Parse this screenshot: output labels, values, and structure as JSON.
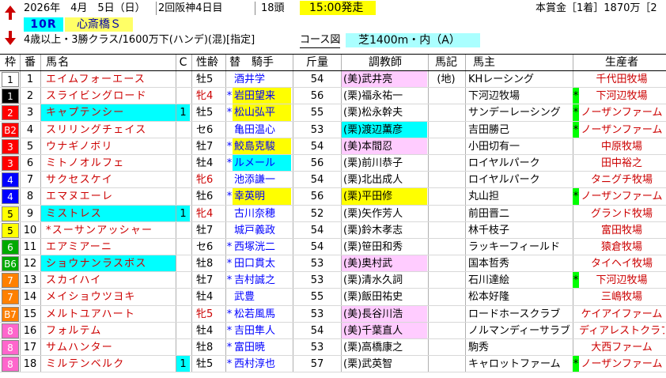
{
  "header": {
    "date": "2026年　4月　5日（日）",
    "meeting": "2回阪神4日目",
    "runners": "18頭",
    "post_time": "15:00発走",
    "prize": "本賞金［1着］1870万［2",
    "race_number": "10R",
    "race_name": "心斎橋Ｓ",
    "conditions": "4歳以上・3勝クラス/1600万下(ハンデ)(混)[指定]",
    "course_label": "コース図",
    "course": "芝1400m・内（A）"
  },
  "columns": {
    "waku": "枠",
    "ban": "番",
    "horse": "馬名",
    "blink": "C",
    "sexage": "性齢",
    "jockey": "替　騎手",
    "kin": "斤量",
    "trainer": "調教師",
    "memo": "馬記",
    "owner": "馬主",
    "breeder": "生産者"
  },
  "colors": {
    "waku": [
      "#ffffff",
      "#000000",
      "#ff0000",
      "#0000ff",
      "#ffff00",
      "#00aa00",
      "#ff8000",
      "#ff66cc"
    ],
    "jockey_highlight": "#ffff00",
    "jockey_highlight2": "#00ffff",
    "trainer_ritto": "#ffccff",
    "trainer_ritto_hl": "#00ffff",
    "horse_blink_hl": "#00ffff"
  },
  "rows": [
    {
      "waku": "1",
      "wc": 0,
      "ban": "1",
      "horse": "エイムフォーエース",
      "blink": "",
      "sexage": "牡5",
      "mark": "",
      "jockey": "酒井学",
      "jhl": "",
      "kin": "54",
      "trainer": "(美)武井亮",
      "thl": "miho",
      "memo": "(地)",
      "owner": "KHレーシング",
      "gm": "",
      "breeder": "千代田牧場",
      "hhl": ""
    },
    {
      "waku": "1",
      "wc": 1,
      "ban": "2",
      "horse": "スライビングロード",
      "blink": "",
      "sexage": "牝4",
      "sexred": true,
      "mark": "*",
      "jockey": "岩田望来",
      "jhl": "y",
      "kin": "56",
      "trainer": "(栗)福永祐一",
      "thl": "",
      "memo": "",
      "owner": "下河辺牧場",
      "gm": "",
      "breeder": "下河辺牧場",
      "bgm": "*"
    },
    {
      "waku": "2",
      "wc": 2,
      "ban": "3",
      "horse": "キャプテンシー",
      "blink": "1",
      "sexage": "牡5",
      "mark": "*",
      "jockey": "松山弘平",
      "jhl": "y",
      "kin": "55",
      "trainer": "(栗)松永幹夫",
      "thl": "",
      "memo": "",
      "owner": "サンデーレーシング",
      "gm": "",
      "breeder": "ノーザンファーム",
      "bgm": "*",
      "hhl": "c"
    },
    {
      "waku": "B2",
      "wc": 2,
      "ban": "4",
      "horse": "スリリングチェイス",
      "blink": "",
      "sexage": "セ6",
      "mark": "",
      "jockey": "亀田温心",
      "jhl": "",
      "kin": "53",
      "trainer": "(栗)渡辺薫彦",
      "thl": "c",
      "memo": "",
      "owner": "吉田勝己",
      "gm": "",
      "breeder": "ノーザンファーム",
      "bgm": "*"
    },
    {
      "waku": "3",
      "wc": 2,
      "ban": "5",
      "horse": "ウナギノボリ",
      "blink": "",
      "sexage": "牡7",
      "mark": "*",
      "jockey": "鮫島克駿",
      "jhl": "y",
      "kin": "54",
      "trainer": "(美)本間忍",
      "thl": "miho",
      "memo": "",
      "owner": "小田切有一",
      "gm": "",
      "breeder": "中原牧場"
    },
    {
      "waku": "3",
      "wc": 2,
      "ban": "6",
      "horse": "ミトノオルフェ",
      "blink": "",
      "sexage": "牡4",
      "mark": "*",
      "jockey": "ルメール",
      "jhl": "c",
      "kin": "56",
      "trainer": "(栗)前川恭子",
      "thl": "",
      "memo": "",
      "owner": "ロイヤルパーク",
      "gm": "",
      "breeder": "田中裕之"
    },
    {
      "waku": "4",
      "wc": 3,
      "ban": "7",
      "horse": "サクセスケイ",
      "blink": "",
      "sexage": "牝6",
      "sexred": true,
      "mark": "",
      "jockey": "池添謙一",
      "jhl": "",
      "kin": "54",
      "trainer": "(栗)北出成人",
      "thl": "",
      "memo": "",
      "owner": "ロイヤルパーク",
      "gm": "",
      "breeder": "タニグチ牧場"
    },
    {
      "waku": "4",
      "wc": 3,
      "ban": "8",
      "horse": "エマヌエーレ",
      "blink": "",
      "sexage": "牡6",
      "mark": "*",
      "jockey": "幸英明",
      "jhl": "y",
      "kin": "56",
      "trainer": "(栗)平田修",
      "thl": "y",
      "memo": "",
      "owner": "丸山担",
      "gm": "",
      "breeder": "ノーザンファーム",
      "bgm": "*"
    },
    {
      "waku": "5",
      "wc": 4,
      "ban": "9",
      "horse": "ミストレス",
      "blink": "1",
      "sexage": "牝4",
      "sexred": true,
      "mark": "",
      "jockey": "古川奈穂",
      "jhl": "",
      "kin": "52",
      "trainer": "(栗)矢作芳人",
      "thl": "",
      "memo": "",
      "owner": "前田晋二",
      "gm": "",
      "breeder": "グランド牧場",
      "hhl": "c"
    },
    {
      "waku": "5",
      "wc": 4,
      "ban": "10",
      "horse": "*スーサンアッシャー",
      "blink": "",
      "sexage": "牡7",
      "mark": "",
      "jockey": "城戸義政",
      "jhl": "",
      "kin": "54",
      "trainer": "(栗)鈴木孝志",
      "thl": "",
      "memo": "",
      "owner": "林千枝子",
      "gm": "",
      "breeder": "富田牧場"
    },
    {
      "waku": "6",
      "wc": 5,
      "ban": "11",
      "horse": "エアミアーニ",
      "blink": "",
      "sexage": "セ6",
      "mark": "*",
      "jockey": "西塚洸二",
      "jhl": "",
      "kin": "54",
      "trainer": "(栗)笹田和秀",
      "thl": "",
      "memo": "",
      "owner": "ラッキーフィールド",
      "gm": "",
      "breeder": "猿倉牧場"
    },
    {
      "waku": "B6",
      "wc": 5,
      "ban": "12",
      "horse": "ショウナンラスボス",
      "blink": "",
      "sexage": "牡8",
      "mark": "*",
      "jockey": "田口貫太",
      "jhl": "",
      "kin": "53",
      "trainer": "(美)奥村武",
      "thl": "miho",
      "memo": "",
      "owner": "国本哲秀",
      "gm": "",
      "breeder": "タイヘイ牧場",
      "hhl": "c"
    },
    {
      "waku": "7",
      "wc": 6,
      "ban": "13",
      "horse": "スカイハイ",
      "blink": "",
      "sexage": "牡7",
      "mark": "*",
      "jockey": "吉村誠之",
      "jhl": "",
      "kin": "53",
      "trainer": "(栗)清水久詞",
      "thl": "",
      "memo": "",
      "owner": "石川達絵",
      "gm": "",
      "breeder": "下河辺牧場",
      "bgm": "*"
    },
    {
      "waku": "7",
      "wc": 6,
      "ban": "14",
      "horse": "メイショウツヨキ",
      "blink": "",
      "sexage": "牡4",
      "mark": "",
      "jockey": "武豊",
      "jhl": "",
      "kin": "55",
      "trainer": "(栗)飯田祐史",
      "thl": "",
      "memo": "",
      "owner": "松本好隆",
      "gm": "",
      "breeder": "三嶋牧場"
    },
    {
      "waku": "B7",
      "wc": 6,
      "ban": "15",
      "horse": "メルトユアハート",
      "blink": "",
      "sexage": "牝5",
      "sexred": true,
      "mark": "*",
      "jockey": "松若風馬",
      "jhl": "",
      "kin": "53",
      "trainer": "(美)長谷川浩",
      "thl": "miho",
      "memo": "",
      "owner": "ロードホースクラブ",
      "gm": "",
      "breeder": "ケイアイファーム"
    },
    {
      "waku": "8",
      "wc": 7,
      "ban": "16",
      "horse": "フォルテム",
      "blink": "",
      "sexage": "牡4",
      "mark": "*",
      "jockey": "吉田隼人",
      "jhl": "",
      "kin": "54",
      "trainer": "(美)千葉直人",
      "thl": "miho",
      "memo": "",
      "owner": "ノルマンディーサラブ",
      "gm": "",
      "breeder": "ディアレストクラブ"
    },
    {
      "waku": "8",
      "wc": 7,
      "ban": "17",
      "horse": "サムハンター",
      "blink": "",
      "sexage": "牡8",
      "mark": "*",
      "jockey": "富田暁",
      "jhl": "",
      "kin": "53",
      "trainer": "(栗)高橋康之",
      "thl": "",
      "memo": "",
      "owner": "駒秀",
      "gm": "",
      "breeder": "大西ファーム"
    },
    {
      "waku": "8",
      "wc": 7,
      "ban": "18",
      "horse": "ミルテンベルク",
      "blink": "1",
      "sexage": "牡5",
      "mark": "*",
      "jockey": "西村淳也",
      "jhl": "",
      "kin": "57",
      "trainer": "(栗)武英智",
      "thl": "",
      "memo": "",
      "owner": "キャロットファーム",
      "gm": "",
      "breeder": "ノーザンファーム",
      "bgm": "*"
    }
  ]
}
